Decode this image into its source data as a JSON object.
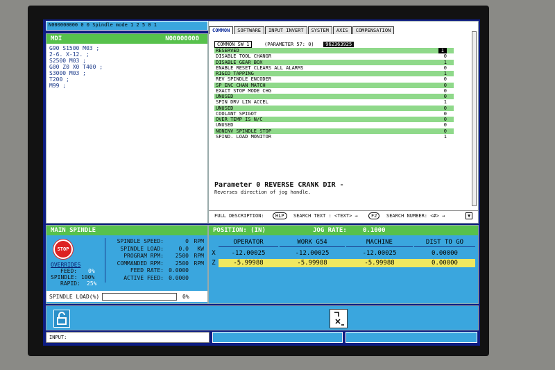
{
  "top_status": {
    "mode_text": "N000000000   0   0 Spindle mode 1 2 5  0  1"
  },
  "mdi": {
    "title": "MDI",
    "program": "N00000000",
    "code": "G90 S1500 M03 ;\n2-6. X-12. ;\nS2500 M03 ;\nG00 Z0 X0 T400 ;\nS3000 M03 ;\nT200 ;\nM99 ;"
  },
  "tabs": [
    "COMMON",
    "SOFTWARE",
    "INPUT INVERT",
    "SYSTEM",
    "AXIS",
    "COMPENSATION"
  ],
  "common_sw": {
    "label": "COMMON SW 1",
    "param_text": "(PARAMETER   57: 0)",
    "value": "962363925",
    "rows": [
      {
        "label": "RESERVED",
        "value": "1",
        "green": true
      },
      {
        "label": "DISABLE TOOL CHANGR",
        "value": "0",
        "green": false
      },
      {
        "label": "DISABLE GEAR BOX",
        "value": "1",
        "green": true
      },
      {
        "label": "ENABLE RESET CLEARS ALL ALARMS",
        "value": "0",
        "green": false
      },
      {
        "label": "RIGID TAPPING",
        "value": "1",
        "green": true
      },
      {
        "label": "REV SPINDLE ENCODER",
        "value": "0",
        "green": false
      },
      {
        "label": "SP ENC CHAN MATCH",
        "value": "0",
        "green": true
      },
      {
        "label": "EXACT STOP MODE CHG",
        "value": "0",
        "green": false
      },
      {
        "label": "UNUSED",
        "value": "0",
        "green": true
      },
      {
        "label": "SPIN DRV LIN ACCEL",
        "value": "1",
        "green": false
      },
      {
        "label": "UNUSED",
        "value": "0",
        "green": true
      },
      {
        "label": "COOLANT SPIGOT",
        "value": "0",
        "green": false
      },
      {
        "label": "OVER TEMP IS N/C",
        "value": "0",
        "green": true
      },
      {
        "label": "UNUSED",
        "value": "0",
        "green": false
      },
      {
        "label": "NONINV SPINDLE STOP",
        "value": "0",
        "green": true
      },
      {
        "label": "SPIND. LOAD MONITOR",
        "value": "1",
        "green": false
      }
    ],
    "param_title": "Parameter 0 REVERSE CRANK DIR -",
    "param_desc": "Reverses direction of jog handle."
  },
  "help_bar": {
    "full_desc": "FULL DESCRIPTION:",
    "key1": "HLP",
    "search_text": "SEARCH TEXT : <TEXT> →",
    "key2": "F2",
    "search_num": "SEARCH NUMBER: <#> →"
  },
  "spindle": {
    "title": "MAIN SPINDLE",
    "stop": "STOP",
    "overrides_label": "OVERRIDES",
    "feed_label": "FEED:",
    "feed_val": "0%",
    "spindle_label": "SPINDLE:",
    "spindle_val": "100%",
    "rapid_label": "RAPID:",
    "rapid_val": "25%",
    "stats": [
      {
        "label": "SPINDLE SPEED:",
        "value": "0",
        "unit": "RPM"
      },
      {
        "label": "SPINDLE LOAD:",
        "value": "0.0",
        "unit": "KW"
      },
      {
        "label": "PROGRAM RPM:",
        "value": "2500",
        "unit": "RPM"
      },
      {
        "label": "COMMANDED RPM:",
        "value": "2500",
        "unit": "RPM"
      },
      {
        "label": "FEED RATE:",
        "value": "0.0000",
        "unit": ""
      },
      {
        "label": "ACTIVE FEED:",
        "value": "0.0000",
        "unit": ""
      }
    ],
    "load_label": "SPINDLE LOAD(%)",
    "load_val": "0%",
    "load_fraction": 0
  },
  "position": {
    "title": "POSITION: (IN)",
    "jog_label": "JOG RATE:",
    "jog_val": "0.1000",
    "headers": [
      "OPERATOR",
      "WORK G54",
      "MACHINE",
      "DIST TO GO"
    ],
    "rows": [
      {
        "axis": "X",
        "values": [
          "-12.00025",
          "-12.00025",
          "-12.00025",
          "0.00000"
        ],
        "selected": false
      },
      {
        "axis": "Z",
        "values": [
          "-5.99988",
          "-5.99988",
          "-5.99988",
          "0.00000"
        ],
        "selected": true
      }
    ]
  },
  "bottom": {
    "input_label": "INPUT:"
  },
  "colors": {
    "accent_green": "#57c14c",
    "selection_yellow": "#f0e860",
    "panel_blue": "#3aa6de"
  }
}
